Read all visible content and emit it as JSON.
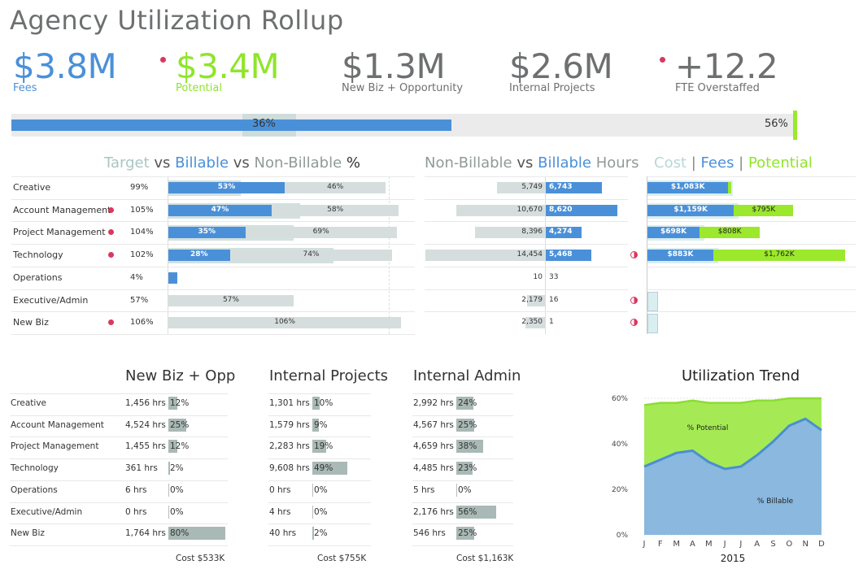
{
  "title": "Agency Utilization Rollup",
  "colors": {
    "fees": "#4a90d9",
    "potential": "#9be82c",
    "gray": "#6d6f70",
    "target": "#cfdcdc",
    "alert": "#d9385f"
  },
  "kpis": [
    {
      "value": "$3.8M",
      "label": "Fees",
      "color": "#4a90d9",
      "dot": false
    },
    {
      "value": "$3.4M",
      "label": "Potential",
      "color": "#8fe52b",
      "dot": true
    },
    {
      "value": "$1.3M",
      "label": "New Biz + Opportunity",
      "color": "#6d6f70",
      "dot": false
    },
    {
      "value": "$2.6M",
      "label": "Internal Projects",
      "color": "#6d6f70",
      "dot": false
    },
    {
      "value": "+12.2",
      "label": "FTE Overstaffed",
      "color": "#6d6f70",
      "dot": true
    }
  ],
  "overall": {
    "billable_label": "36%",
    "total_label": "56%",
    "billable": 0.36,
    "total": 0.56
  },
  "sections": {
    "util_header": {
      "target": "Target",
      "vs1": " vs ",
      "billable": "Billable",
      "vs2": " vs ",
      "nonbillable": "Non-Billable",
      "pct": " %"
    },
    "hours_header": {
      "nonbillable": "Non-Billable",
      "vs": " vs ",
      "billable": "Billable",
      "hours": " Hours"
    },
    "money_header": {
      "cost": "Cost",
      "sep1": " | ",
      "fees": "Fees",
      "sep2": " | ",
      "potential": "Potential"
    }
  },
  "departments": [
    {
      "name": "Creative",
      "dot": false,
      "util": "99%",
      "billable_pct": 53,
      "billable_label": "53%",
      "nonbill_pct": 46,
      "nonbill_label": "46%",
      "target": 0.33,
      "nb_hours": 5749,
      "nb_hours_label": "5,749",
      "b_hours": 6743,
      "b_hours_label": "6,743",
      "flag": false,
      "fees": 1083,
      "fees_label": "$1,083K",
      "potential": 0,
      "potential_label": ""
    },
    {
      "name": "Account Management",
      "dot": true,
      "util": "105%",
      "billable_pct": 47,
      "billable_label": "47%",
      "nonbill_pct": 58,
      "nonbill_label": "58%",
      "target": 0.6,
      "nb_hours": 10670,
      "nb_hours_label": "10,670",
      "b_hours": 8620,
      "b_hours_label": "8,620",
      "flag": false,
      "fees": 1159,
      "fees_label": "$1,159K",
      "potential": 795,
      "potential_label": "$795K"
    },
    {
      "name": "Project Management",
      "dot": true,
      "util": "104%",
      "billable_pct": 35,
      "billable_label": "35%",
      "nonbill_pct": 69,
      "nonbill_label": "69%",
      "target": 0.57,
      "nb_hours": 8396,
      "nb_hours_label": "8,396",
      "b_hours": 4274,
      "b_hours_label": "4,274",
      "flag": false,
      "fees": 698,
      "fees_label": "$698K",
      "potential": 808,
      "potential_label": "$808K"
    },
    {
      "name": "Technology",
      "dot": true,
      "util": "102%",
      "billable_pct": 28,
      "billable_label": "28%",
      "nonbill_pct": 74,
      "nonbill_label": "74%",
      "target": 0.75,
      "nb_hours": 14454,
      "nb_hours_label": "14,454",
      "b_hours": 5468,
      "b_hours_label": "5,468",
      "flag": true,
      "fees": 883,
      "fees_label": "$883K",
      "potential": 1762,
      "potential_label": "$1,762K"
    },
    {
      "name": "Operations",
      "dot": false,
      "util": "4%",
      "billable_pct": 4,
      "billable_label": "",
      "nonbill_pct": 0,
      "nonbill_label": "",
      "target": 0,
      "nb_hours": 10,
      "nb_hours_label": "10",
      "b_hours": 33,
      "b_hours_label": "33",
      "flag": false,
      "fees": 0,
      "fees_label": "",
      "potential": 0,
      "potential_label": ""
    },
    {
      "name": "Executive/Admin",
      "dot": false,
      "util": "57%",
      "billable_pct": 0,
      "billable_label": "",
      "nonbill_pct": 57,
      "nonbill_label": "57%",
      "target": 0,
      "nb_hours": 2179,
      "nb_hours_label": "2,179",
      "b_hours": 16,
      "b_hours_label": "16",
      "flag": true,
      "fees": 0,
      "fees_label": "",
      "potential": 0,
      "potential_label": ""
    },
    {
      "name": "New Biz",
      "dot": true,
      "util": "106%",
      "billable_pct": 0,
      "billable_label": "",
      "nonbill_pct": 106,
      "nonbill_label": "106%",
      "target": 0,
      "nb_hours": 2350,
      "nb_hours_label": "2,350",
      "b_hours": 1,
      "b_hours_label": "1",
      "flag": true,
      "fees": 0,
      "fees_label": "",
      "potential": 0,
      "potential_label": ""
    }
  ],
  "breakdown": {
    "titles": [
      "New Biz + Opp",
      "Internal Projects",
      "Internal Admin"
    ],
    "rows": [
      {
        "name": "Creative",
        "cols": [
          {
            "hrs": "1,456 hrs",
            "pct": "12%",
            "v": 12
          },
          {
            "hrs": "1,301 hrs",
            "pct": "10%",
            "v": 10
          },
          {
            "hrs": "2,992 hrs",
            "pct": "24%",
            "v": 24
          }
        ]
      },
      {
        "name": "Account Management",
        "cols": [
          {
            "hrs": "4,524 hrs",
            "pct": "25%",
            "v": 25
          },
          {
            "hrs": "1,579 hrs",
            "pct": "9%",
            "v": 9
          },
          {
            "hrs": "4,567 hrs",
            "pct": "25%",
            "v": 25
          }
        ]
      },
      {
        "name": "Project Management",
        "cols": [
          {
            "hrs": "1,455 hrs",
            "pct": "12%",
            "v": 12
          },
          {
            "hrs": "2,283 hrs",
            "pct": "19%",
            "v": 19
          },
          {
            "hrs": "4,659 hrs",
            "pct": "38%",
            "v": 38
          }
        ]
      },
      {
        "name": "Technology",
        "cols": [
          {
            "hrs": "361 hrs",
            "pct": "2%",
            "v": 2
          },
          {
            "hrs": "9,608 hrs",
            "pct": "49%",
            "v": 49
          },
          {
            "hrs": "4,485 hrs",
            "pct": "23%",
            "v": 23
          }
        ]
      },
      {
        "name": "Operations",
        "cols": [
          {
            "hrs": "6 hrs",
            "pct": "0%",
            "v": 0
          },
          {
            "hrs": "0 hrs",
            "pct": "0%",
            "v": 0
          },
          {
            "hrs": "5 hrs",
            "pct": "0%",
            "v": 0
          }
        ]
      },
      {
        "name": "Executive/Admin",
        "cols": [
          {
            "hrs": "0 hrs",
            "pct": "0%",
            "v": 0
          },
          {
            "hrs": "4 hrs",
            "pct": "0%",
            "v": 0
          },
          {
            "hrs": "2,176 hrs",
            "pct": "56%",
            "v": 56
          }
        ]
      },
      {
        "name": "New Biz",
        "cols": [
          {
            "hrs": "1,764 hrs",
            "pct": "80%",
            "v": 80
          },
          {
            "hrs": "40 hrs",
            "pct": "2%",
            "v": 2
          },
          {
            "hrs": "546 hrs",
            "pct": "25%",
            "v": 25
          }
        ]
      }
    ],
    "costs": [
      "Cost $533K",
      "Cost $755K",
      "Cost $1,163K"
    ]
  },
  "chart_data": {
    "type": "area",
    "title": "Utilization Trend",
    "xlabel": "2015",
    "ylabel": "",
    "categories": [
      "J",
      "F",
      "M",
      "A",
      "M",
      "J",
      "J",
      "A",
      "S",
      "O",
      "N",
      "D"
    ],
    "ylim": [
      0,
      60
    ],
    "yticks": [
      "0%",
      "20%",
      "40%",
      "60%"
    ],
    "series": [
      {
        "name": "% Potential",
        "values": [
          57,
          58,
          58,
          59,
          58,
          58,
          58,
          59,
          59,
          60,
          60,
          60
        ],
        "color": "#a5ea55"
      },
      {
        "name": "% Billable",
        "values": [
          30,
          33,
          36,
          37,
          32,
          29,
          30,
          35,
          41,
          48,
          51,
          46
        ],
        "color": "#8ab8de"
      }
    ]
  }
}
